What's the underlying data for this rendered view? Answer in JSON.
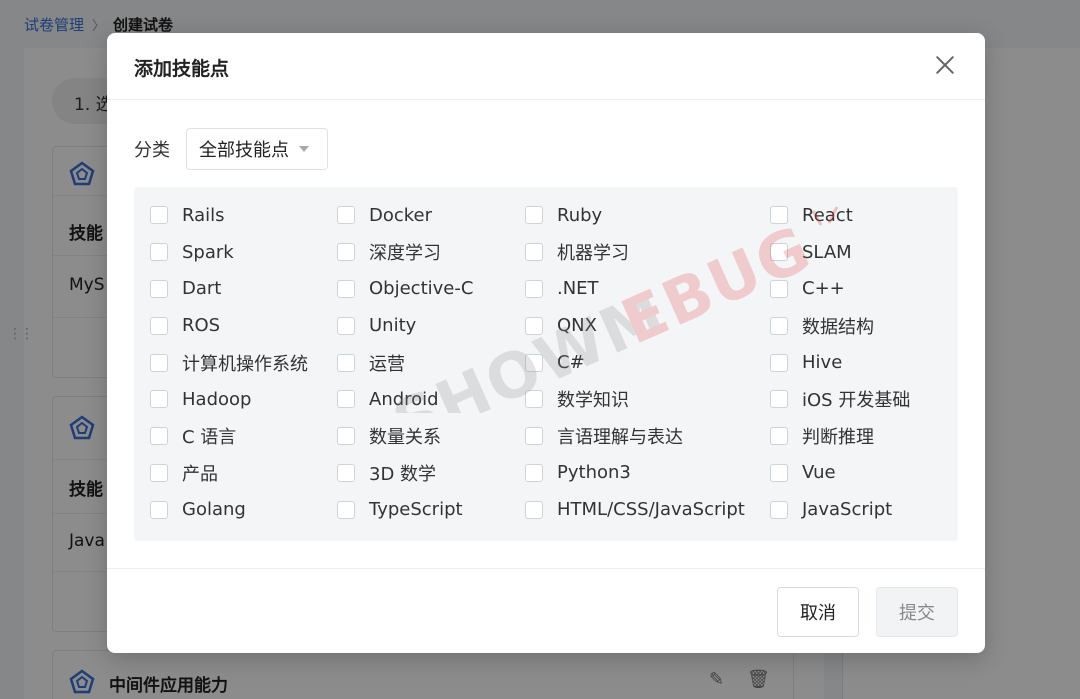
{
  "breadcrumb": {
    "parent": "试卷管理",
    "separator": "〉",
    "current": "创建试卷"
  },
  "background": {
    "step_label": "1. 选",
    "card1": {
      "header_text": "技能",
      "row_text": "MyS"
    },
    "card2": {
      "header_text": "技能",
      "row_text": "Java"
    },
    "card3": {
      "title": "中间件应用能力"
    }
  },
  "modal": {
    "title": "添加技能点",
    "filter_label": "分类",
    "select_value": "全部技能点",
    "skills": [
      "Rails",
      "Docker",
      "Ruby",
      "React",
      "Spark",
      "深度学习",
      "机器学习",
      "SLAM",
      "Dart",
      "Objective-C",
      ".NET",
      "C++",
      "ROS",
      "Unity",
      "QNX",
      "数据结构",
      "计算机操作系统",
      "运营",
      "C#",
      "Hive",
      "Hadoop",
      "Android",
      "数学知识",
      "iOS 开发基础",
      "C 语言",
      "数量关系",
      "言语理解与表达",
      "判断推理",
      "产品",
      "3D 数学",
      "Python3",
      "Vue",
      "Golang",
      "TypeScript",
      "HTML/CSS/JavaScript",
      "JavaScript"
    ],
    "cancel_label": "取消",
    "submit_label": "提交"
  },
  "watermark": {
    "text": "SHOWMEBUG"
  },
  "colors": {
    "link": "#3a6fd8",
    "mask": "rgba(0,0,0,0.45)",
    "watermark_red": "#e23b3b"
  }
}
